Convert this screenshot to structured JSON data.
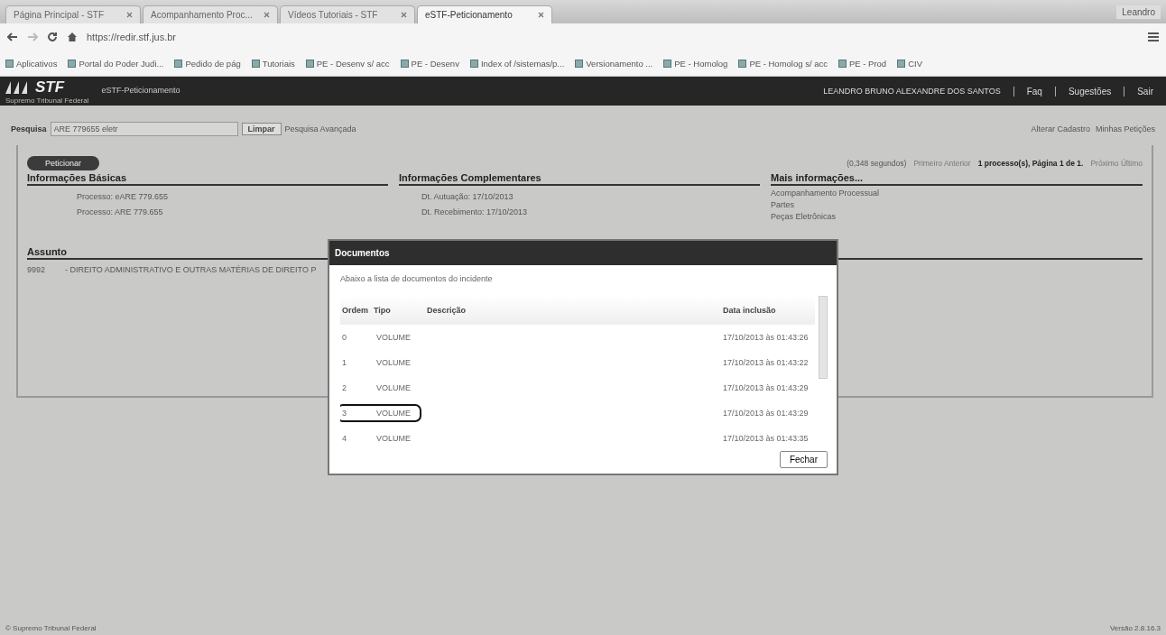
{
  "browser": {
    "tabs": [
      {
        "label": "Página Principal - STF",
        "selected": false
      },
      {
        "label": "Acompanhamento Proc...",
        "selected": false
      },
      {
        "label": "Vídeos Tutoriais - STF",
        "selected": false
      },
      {
        "label": "eSTF-Peticionamento",
        "selected": true
      }
    ],
    "profile": "Leandro",
    "address": "https://redir.stf.jus.br",
    "bookmarks": [
      "Aplicativos",
      "Portal do Poder Judi...",
      "Pedido de pág",
      "Tutoriais",
      "PE - Desenv s/ acc",
      "PE - Desenv",
      "Index of /sistemas/p...",
      "Versionamento ...",
      "PE - Homolog",
      "PE - Homolog s/ acc",
      "PE - Prod",
      "CIV"
    ]
  },
  "header": {
    "logo": "STF",
    "subtitle": "Supremo Tribunal Federal",
    "app": "eSTF-Peticionamento",
    "user": "LEANDRO BRUNO ALEXANDRE DOS SANTOS",
    "links": [
      "Faq",
      "Sugestões",
      "Sair"
    ]
  },
  "search": {
    "label": "Pesquisa",
    "value": "ARE 779655 eletr",
    "clear": "Limpar",
    "advanced": "Pesquisa Avançada",
    "right_links": [
      "Alterar Cadastro",
      "Minhas Petições"
    ]
  },
  "panel": {
    "button": "Peticionar",
    "timing": "(0,348 segundos)",
    "nav_prev": "Primeiro Anterior",
    "count": "1 processo(s), Página 1 de 1.",
    "nav_next": "Próximo Último",
    "basic": {
      "title": "Informações Básicas",
      "rows": [
        "Processo: eARE 779.655",
        "Processo: ARE 779.655"
      ]
    },
    "complementary": {
      "title": "Informações Complementares",
      "rows": [
        "Dt. Autuação: 17/10/2013",
        "Dt. Recebimento: 17/10/2013"
      ]
    },
    "more": {
      "title": "Mais informações...",
      "links": [
        "Acompanhamento Processual",
        "Partes",
        "Peças Eletrônicas"
      ]
    },
    "subject": {
      "title": "Assunto",
      "code": "9992",
      "text": "- DIREITO ADMINISTRATIVO E OUTRAS MATÉRIAS DE DIREITO P"
    }
  },
  "dialog": {
    "title": "Documentos",
    "intro": "Abaixo a lista de documentos do incidente",
    "columns": [
      "Ordem",
      "Tipo",
      "Descrição",
      "Data inclusão"
    ],
    "rows": [
      {
        "order": "0",
        "type": "VOLUME",
        "date": "17/10/2013 às 01:43:26",
        "highlighted": false
      },
      {
        "order": "1",
        "type": "VOLUME",
        "date": "17/10/2013 às 01:43:22",
        "highlighted": false
      },
      {
        "order": "2",
        "type": "VOLUME",
        "date": "17/10/2013 às 01:43:29",
        "highlighted": false
      },
      {
        "order": "3",
        "type": "VOLUME",
        "date": "17/10/2013 às 01:43:29",
        "highlighted": true
      },
      {
        "order": "4",
        "type": "VOLUME",
        "date": "17/10/2013 às 01:43:35",
        "highlighted": false
      }
    ],
    "close": "Fechar"
  },
  "footer": {
    "left": "© Supremo Tribunal Federal",
    "right": "Versão 2.8.16.3"
  }
}
